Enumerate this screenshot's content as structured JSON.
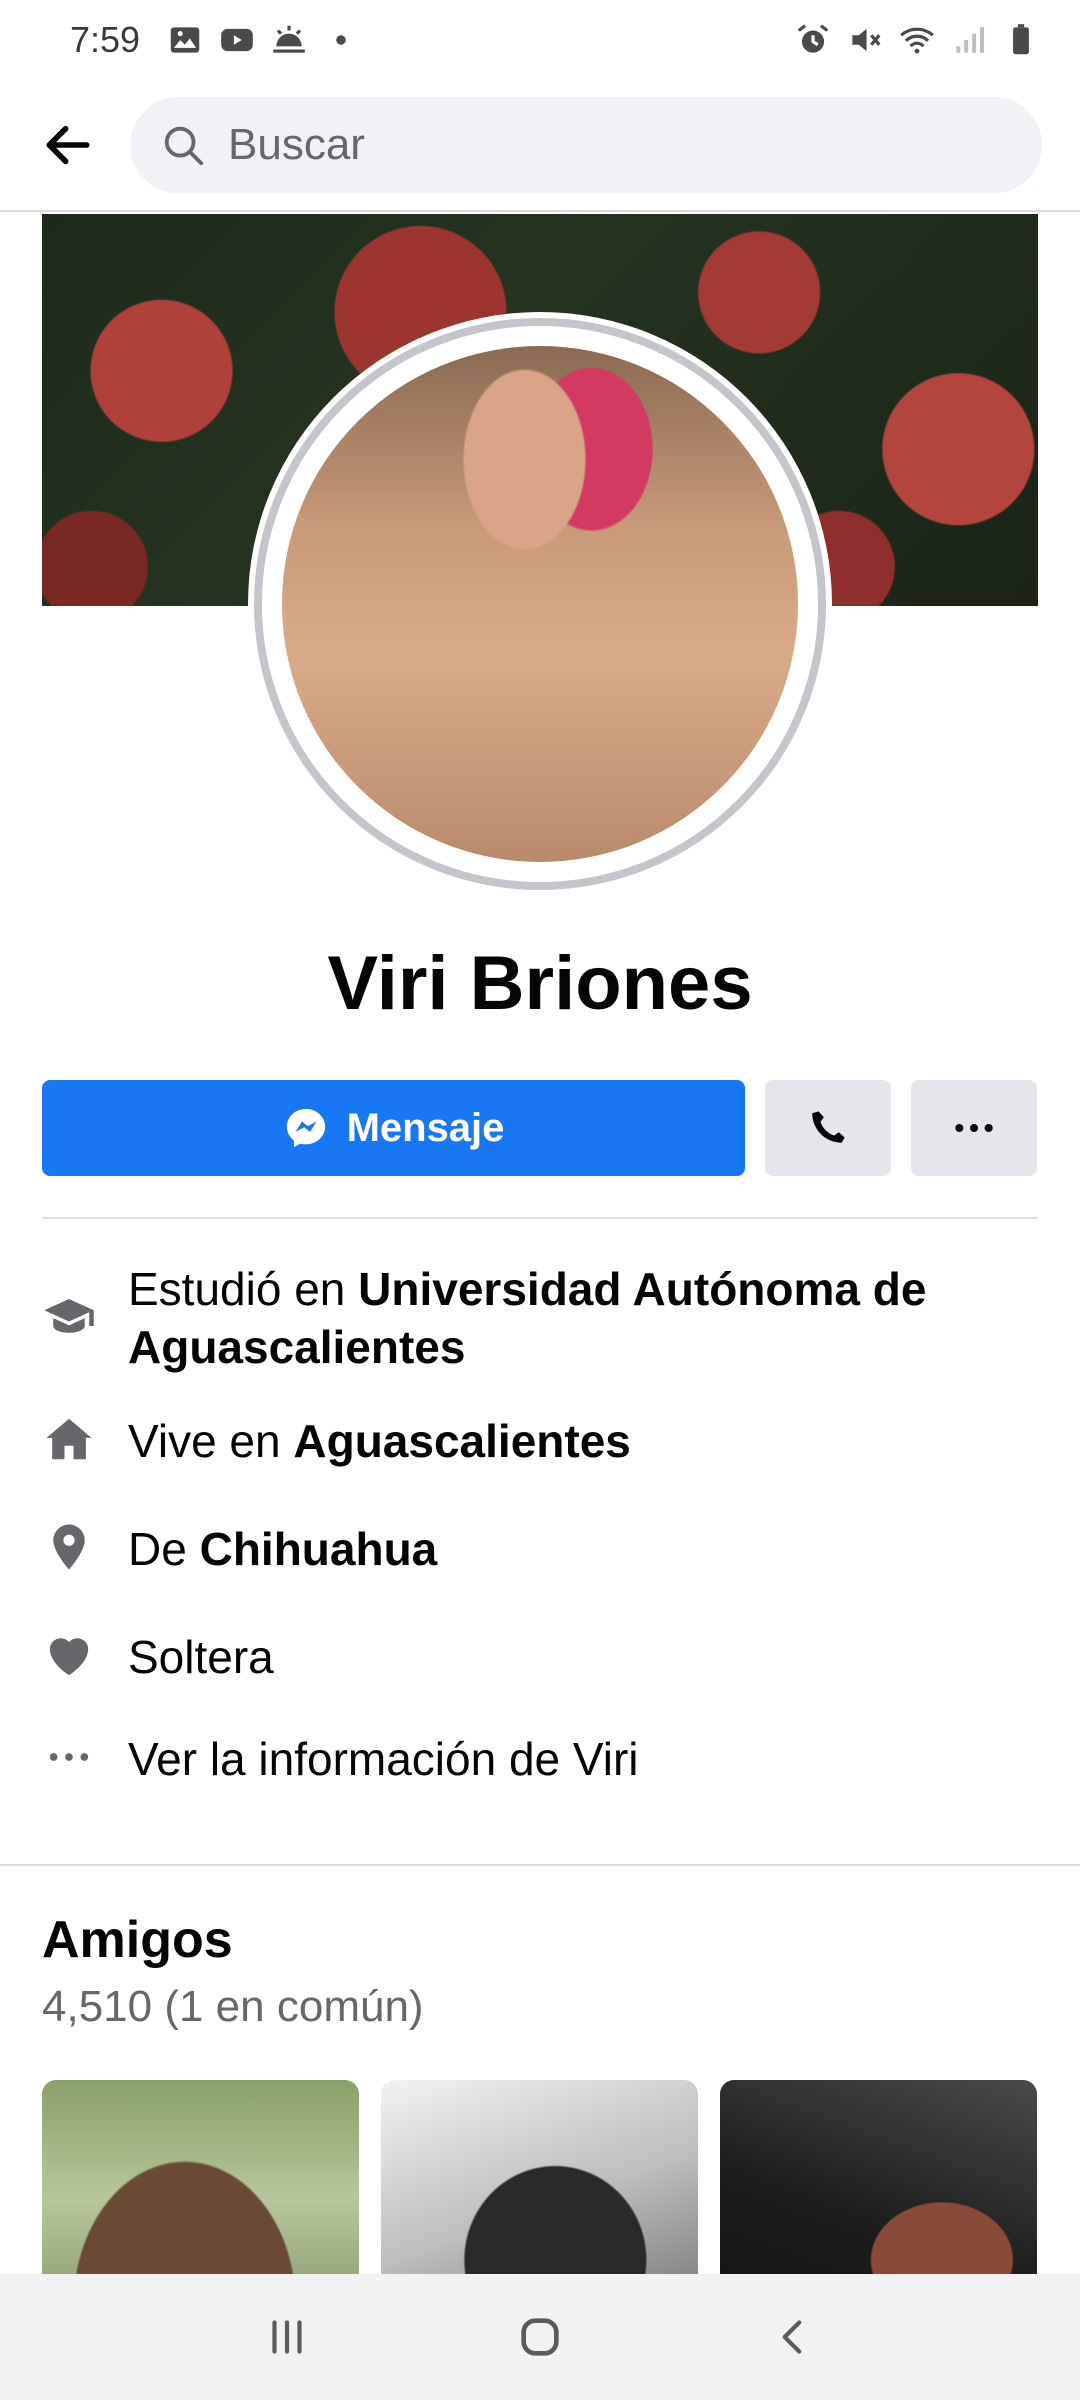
{
  "status_bar": {
    "time": "7:59",
    "left_icons": [
      "image-icon",
      "youtube-icon",
      "weather-icon",
      "dot-icon"
    ],
    "right_icons": [
      "alarm-icon",
      "mute-icon",
      "wifi-icon",
      "signal-icon",
      "battery-icon"
    ]
  },
  "search": {
    "placeholder": "Buscar"
  },
  "profile": {
    "name": "Viri Briones"
  },
  "actions": {
    "message_label": "Mensaje",
    "call_icon": "phone-icon",
    "more_icon": "more-icon"
  },
  "info": {
    "study_prefix": "Estudió en ",
    "study_place": "Universidad Autónoma de Aguascalientes",
    "lives_prefix": "Vive en ",
    "lives_place": "Aguascalientes",
    "from_prefix": "De ",
    "from_place": "Chihuahua",
    "relationship": "Soltera",
    "see_more": "Ver la información de Viri"
  },
  "friends": {
    "title": "Amigos",
    "count": "4,510 (1 en común)"
  },
  "colors": {
    "accent": "#1877f2",
    "gray_button": "#e4e6eb",
    "icon_gray": "#65676b"
  }
}
